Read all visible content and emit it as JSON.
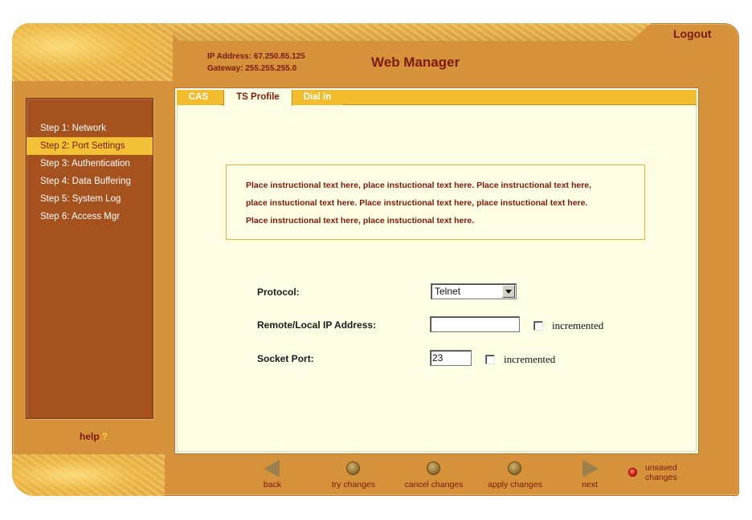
{
  "header": {
    "logout_label": "Logout",
    "ip_address_line": "IP Address:  67.250.85.125",
    "gateway_line": "Gateway:  255.255.255.0",
    "app_title": "Web Manager"
  },
  "sidebar": {
    "items": [
      {
        "label": "Step 1: Network",
        "active": false
      },
      {
        "label": "Step 2: Port Settings",
        "active": true
      },
      {
        "label": "Step 3: Authentication",
        "active": false
      },
      {
        "label": "Step 4: Data Buffering",
        "active": false
      },
      {
        "label": "Step 5: System Log",
        "active": false
      },
      {
        "label": "Step 6: Access Mgr",
        "active": false
      }
    ],
    "help_label": "help",
    "help_symbol": "?"
  },
  "tabs": [
    {
      "label": "CAS",
      "active": false
    },
    {
      "label": "TS Profile",
      "active": true
    },
    {
      "label": "Dial In",
      "active": false
    }
  ],
  "instructions": {
    "line1": "Place instructional text here, place instuctional text here.  Place instructional text here,",
    "line2": "place instuctional text here.  Place instructional text here, place instuctional text here.",
    "line3": "Place instructional text here, place instuctional text here."
  },
  "form": {
    "protocol_label": "Protocol:",
    "protocol_value": "Telnet",
    "remote_ip_label": "Remote/Local IP Address:",
    "remote_ip_value": "",
    "remote_ip_incremented_label": "incremented",
    "remote_ip_incremented_checked": false,
    "socket_port_label": "Socket Port:",
    "socket_port_value": "23",
    "socket_port_incremented_label": "incremented",
    "socket_port_incremented_checked": false
  },
  "toolbar": {
    "back_label": "back",
    "try_label": "try changes",
    "cancel_label": "cancel changes",
    "apply_label": "apply changes",
    "next_label": "next",
    "unsaved_line1": "unsaved",
    "unsaved_line2": "changes"
  },
  "colors": {
    "frame": "#d6923a",
    "sidebar": "#a5521f",
    "active_item": "#f2c135",
    "panel": "#fffde4",
    "text_dark_red": "#7a1a0a",
    "unsaved_indicator": "#e02010"
  }
}
